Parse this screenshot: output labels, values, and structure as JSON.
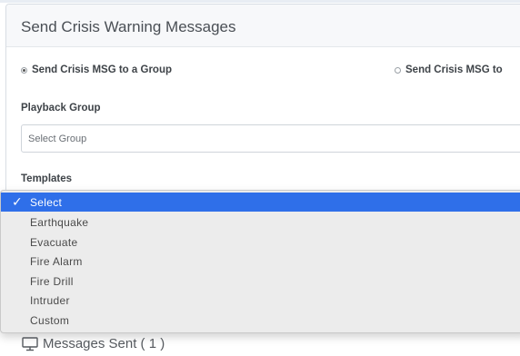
{
  "panel": {
    "title": "Send Crisis Warning Messages"
  },
  "radios": [
    {
      "label": "Send Crisis MSG to a Group",
      "checked": true
    },
    {
      "label": "Send Crisis MSG to",
      "checked": false
    }
  ],
  "playback": {
    "label": "Playback Group",
    "placeholder": "Select Group"
  },
  "templates": {
    "label": "Templates",
    "options": [
      "Select",
      "Earthquake",
      "Evacuate",
      "Fire Alarm",
      "Fire Drill",
      "Intruder",
      "Custom"
    ],
    "selected": "Select"
  },
  "messages_sent": {
    "label": "Messages Sent ( 1 )",
    "icon": "monitor-icon"
  },
  "colors": {
    "selected_highlight": "#2f6fe9",
    "dropdown_bg": "#ececec",
    "header_bg": "#f7f8fa"
  }
}
